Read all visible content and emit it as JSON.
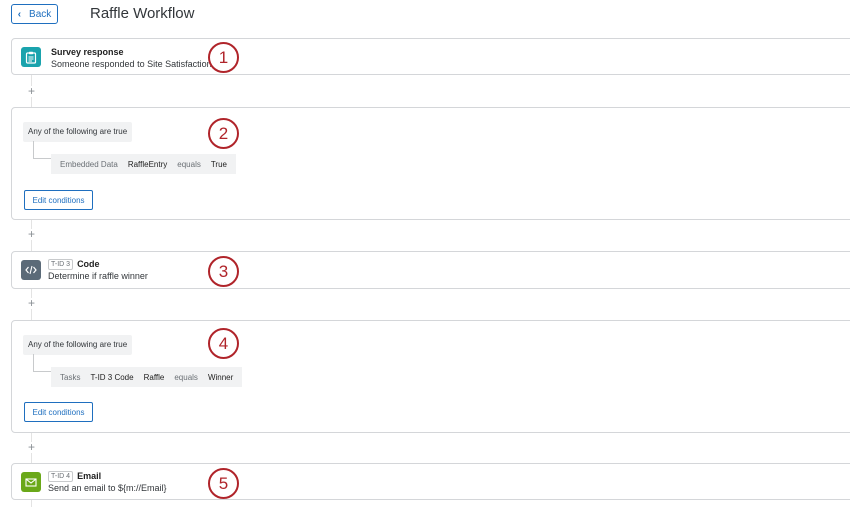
{
  "header": {
    "back_label": "Back",
    "title": "Raffle Workflow"
  },
  "connector_plus": "+",
  "trigger": {
    "icon": "clipboard-icon",
    "title": "Survey response",
    "subtitle": "Someone responded to Site Satisfaction",
    "callout": "1"
  },
  "condition1": {
    "heading": "Any of the following are true",
    "row": [
      "Embedded Data",
      "RaffleEntry",
      "equals",
      "True"
    ],
    "edit_label": "Edit conditions",
    "callout": "2"
  },
  "code_task": {
    "icon": "code-icon",
    "tid": "T-ID 3",
    "title": "Code",
    "subtitle": "Determine if raffle winner",
    "callout": "3"
  },
  "condition2": {
    "heading": "Any of the following are true",
    "row": [
      "Tasks",
      "T-ID 3 Code",
      "Raffle",
      "equals",
      "Winner"
    ],
    "edit_label": "Edit conditions",
    "callout": "4"
  },
  "email_task": {
    "icon": "envelope-icon",
    "tid": "T-ID 4",
    "title": "Email",
    "subtitle": "Send an email to ${m://Email}",
    "callout": "5"
  },
  "colors": {
    "accent": "#1f6fbf",
    "callout": "#b0242a",
    "trigger_icon": "#1aa3ad",
    "code_icon": "#5b6a78",
    "email_icon": "#6aa819"
  }
}
